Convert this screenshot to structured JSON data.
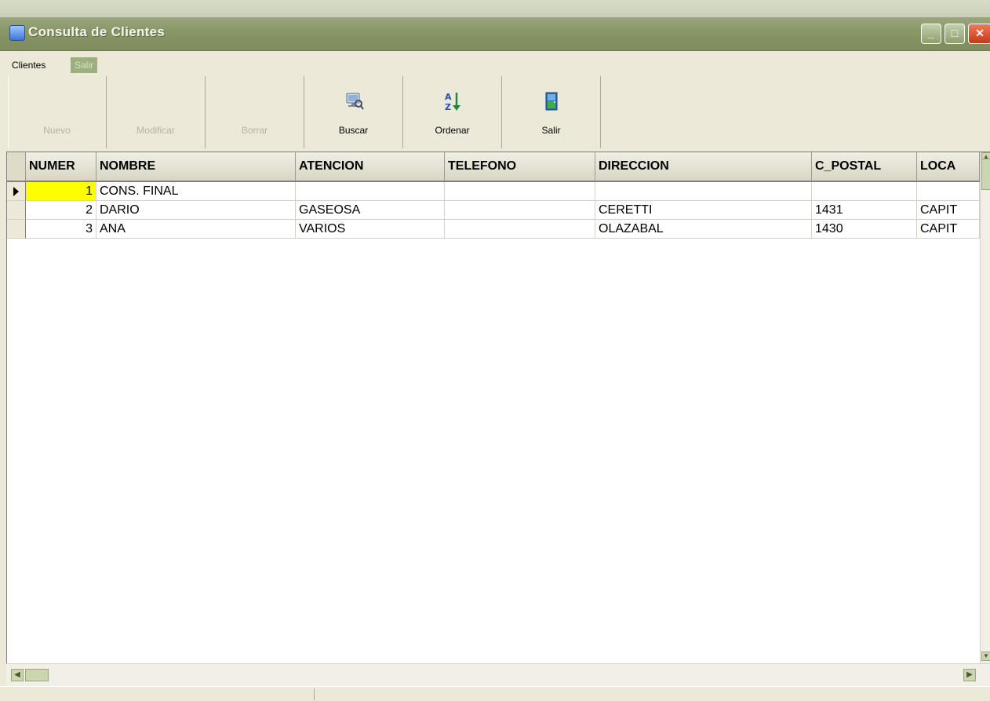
{
  "window": {
    "title": "Consulta de Clientes",
    "controls": {
      "minimize": "_",
      "maximize": "□",
      "close": "✕"
    }
  },
  "menu": [
    {
      "label": "Clientes",
      "active": false
    },
    {
      "label": "Salir",
      "active": true
    }
  ],
  "toolbar": {
    "buttons": [
      {
        "label": "Nuevo",
        "enabled": false,
        "icon": "new-icon"
      },
      {
        "label": "Modificar",
        "enabled": false,
        "icon": "edit-icon"
      },
      {
        "label": "Borrar",
        "enabled": false,
        "icon": "delete-icon"
      },
      {
        "label": "Buscar",
        "enabled": true,
        "icon": "search-computer-icon"
      },
      {
        "label": "Ordenar",
        "enabled": true,
        "icon": "sort-az-icon"
      },
      {
        "label": "Salir",
        "enabled": true,
        "icon": "exit-door-icon"
      }
    ]
  },
  "grid": {
    "columns": [
      "NUMER",
      "NOMBRE",
      "ATENCION",
      "TELEFONO",
      "DIRECCION",
      "C_POSTAL",
      "LOCA"
    ],
    "rows": [
      [
        "1",
        "CONS. FINAL",
        "",
        "",
        "",
        "",
        ""
      ],
      [
        "2",
        "DARIO",
        "GASEOSA",
        "",
        "CERETTI",
        "1431",
        "CAPIT"
      ],
      [
        "3",
        "ANA",
        "VARIOS",
        "",
        "OLAZABAL",
        "1430",
        "CAPIT"
      ]
    ],
    "selected_row": 0,
    "selected_color": "#ffff00"
  },
  "colors": {
    "titlebar": "#8a9868",
    "face": "#ece9d8",
    "close_button": "#c8361a"
  }
}
